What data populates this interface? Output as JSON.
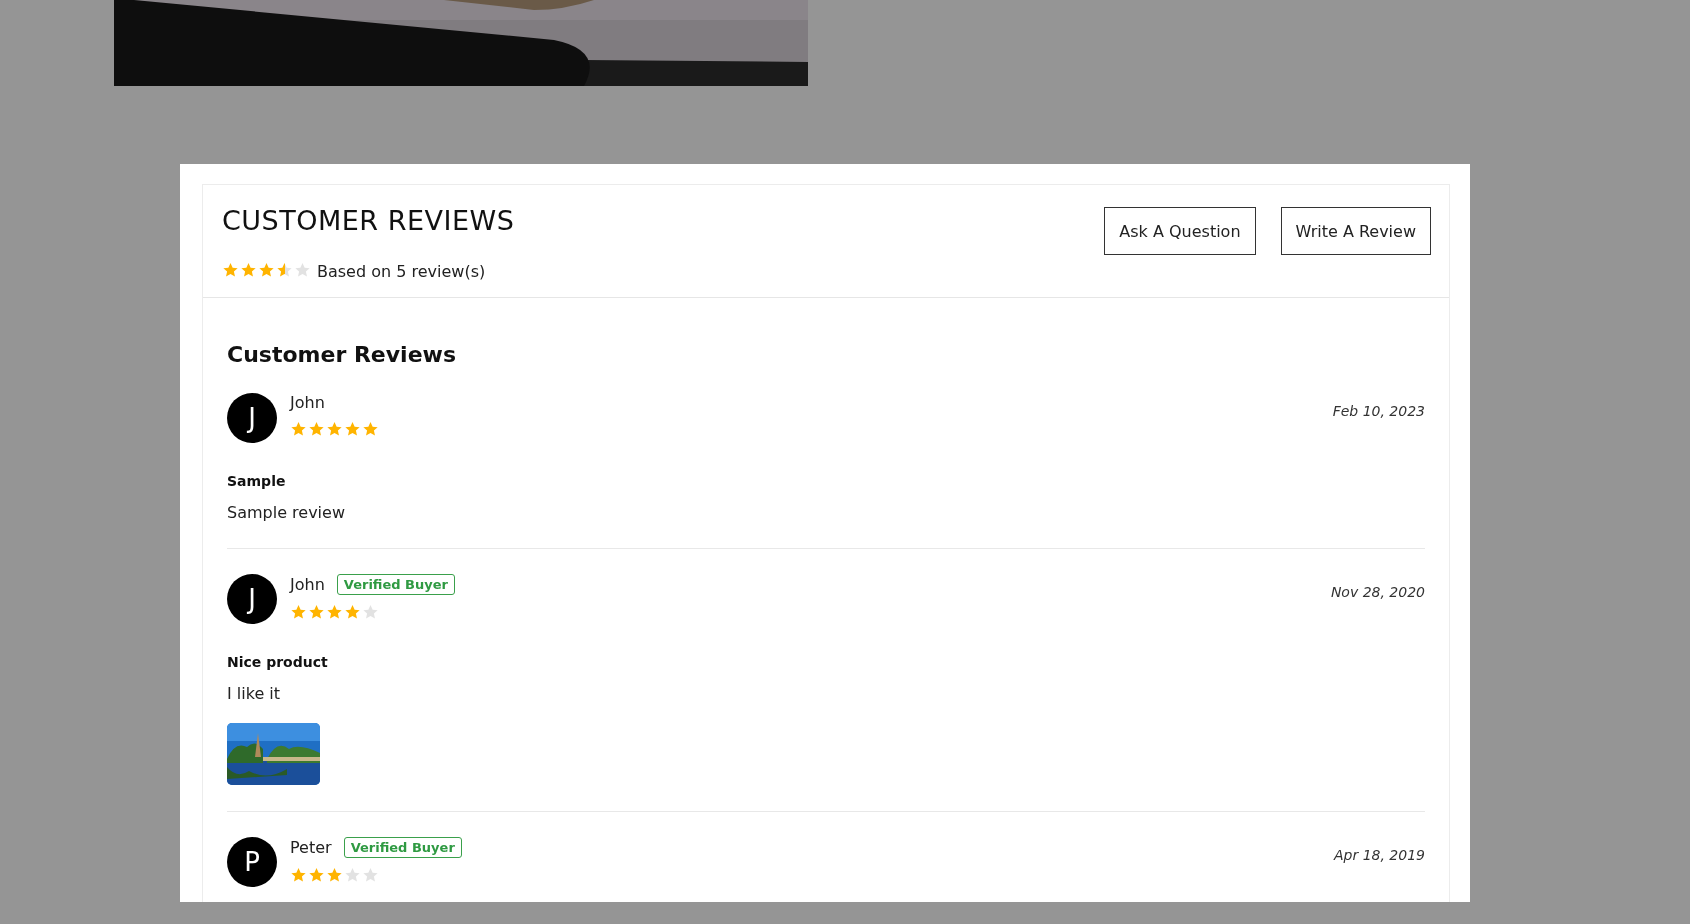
{
  "header": {
    "title": "CUSTOMER REVIEWS",
    "stars": 3.5,
    "summary": "Based on 5 review(s)",
    "buttons": [
      "Ask A Question",
      "Write A Review"
    ]
  },
  "section_title": "Customer Reviews",
  "reviews": [
    {
      "initial": "J",
      "name": "John",
      "verified": false,
      "stars": 5,
      "date": "Feb 10, 2023",
      "title": "Sample",
      "body": "Sample review"
    },
    {
      "initial": "J",
      "name": "John",
      "verified": true,
      "badge": "Verified Buyer",
      "stars": 4,
      "date": "Nov 28, 2020",
      "title": "Nice product",
      "body": "I like it"
    },
    {
      "initial": "P",
      "name": "Peter",
      "verified": true,
      "badge": "Verified Buyer",
      "stars": 3,
      "date": "Apr 18, 2019"
    }
  ]
}
